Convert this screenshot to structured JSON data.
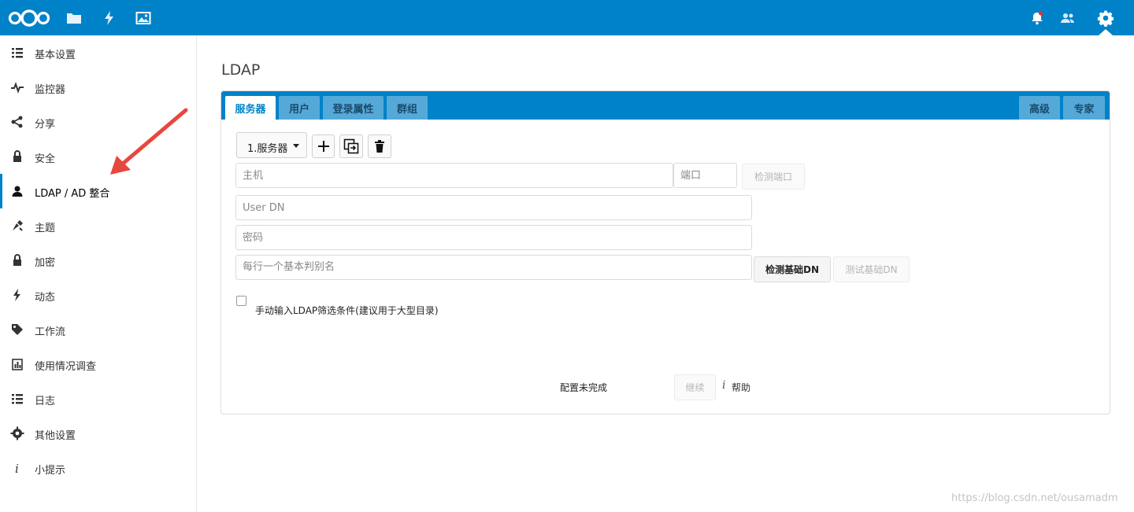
{
  "header": {
    "icons": [
      "nextcloud-logo",
      "files-icon",
      "activity-icon",
      "gallery-icon",
      "notifications-icon",
      "contacts-icon",
      "settings-icon"
    ],
    "color": "#0082c9"
  },
  "sidebar": {
    "items": [
      {
        "label": "基本设置",
        "icon": "list-icon",
        "active": false
      },
      {
        "label": "监控器",
        "icon": "pulse-icon",
        "active": false
      },
      {
        "label": "分享",
        "icon": "share-icon",
        "active": false
      },
      {
        "label": "安全",
        "icon": "lock-icon",
        "active": false
      },
      {
        "label": "LDAP / AD 整合",
        "icon": "user-icon",
        "active": true
      },
      {
        "label": "主题",
        "icon": "brush-icon",
        "active": false
      },
      {
        "label": "加密",
        "icon": "lock-icon",
        "active": false
      },
      {
        "label": "动态",
        "icon": "lightning-icon",
        "active": false
      },
      {
        "label": "工作流",
        "icon": "tag-icon",
        "active": false
      },
      {
        "label": "使用情况调查",
        "icon": "chart-icon",
        "active": false
      },
      {
        "label": "日志",
        "icon": "list-icon",
        "active": false
      },
      {
        "label": "其他设置",
        "icon": "gear-icon",
        "active": false
      },
      {
        "label": "小提示",
        "icon": "info-icon",
        "active": false
      }
    ]
  },
  "main": {
    "title": "LDAP",
    "tabs": [
      "服务器",
      "用户",
      "登录属性",
      "群组"
    ],
    "right_tabs": [
      "高级",
      "专家"
    ],
    "server_select": "1.服务器",
    "host_placeholder": "主机",
    "port_placeholder": "端口",
    "detect_port": "检测端口",
    "user_dn_placeholder": "User DN",
    "password_placeholder": "密码",
    "base_dn_placeholder": "每行一个基本判别名",
    "detect_base_dn": "检测基础DN",
    "test_base_dn": "测试基础DN",
    "manual_filter_label": "手动输入LDAP筛选条件(建议用于大型目录)",
    "status": "配置未完成",
    "continue": "继续",
    "help": "帮助"
  },
  "watermark": "https://blog.csdn.net/ousamadm"
}
